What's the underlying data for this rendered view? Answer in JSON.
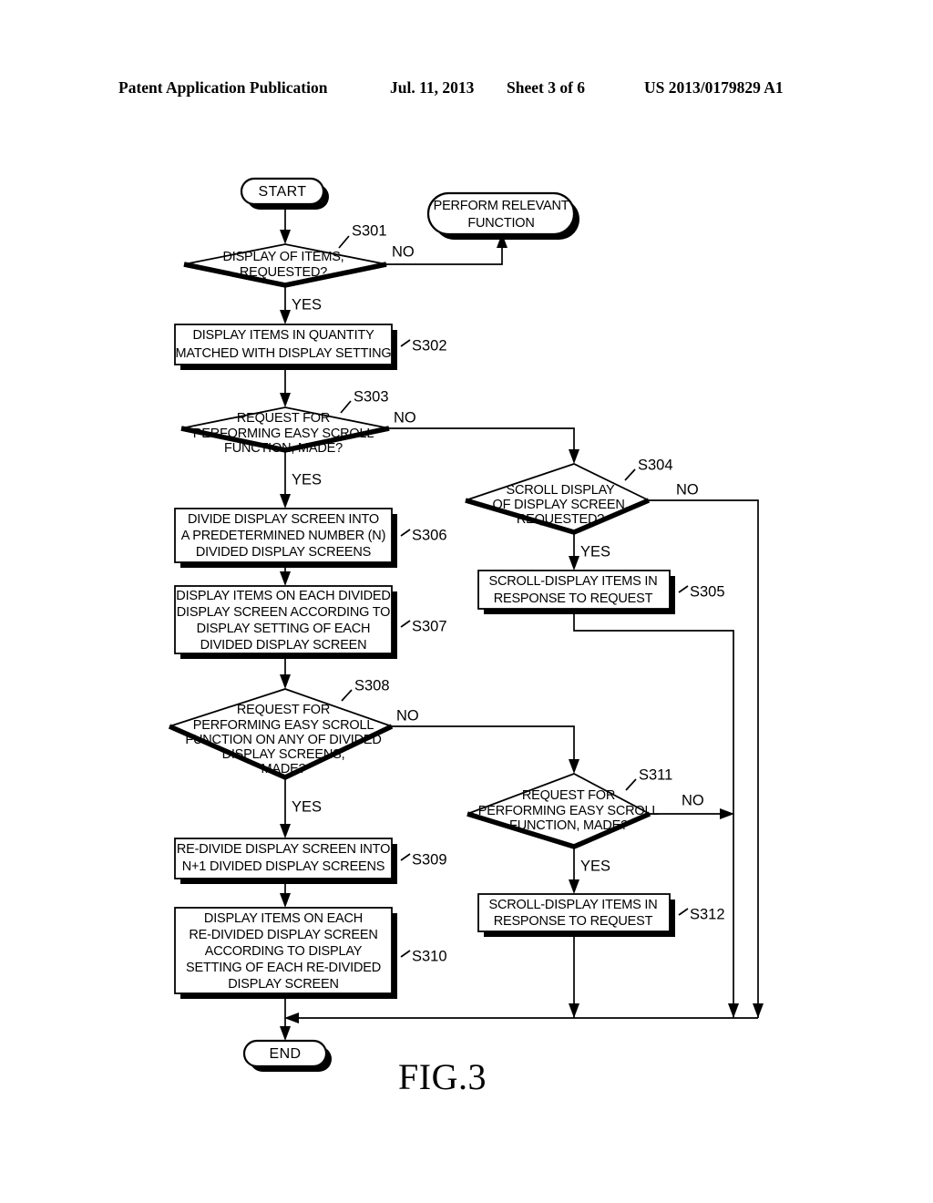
{
  "header": {
    "publication": "Patent Application Publication",
    "date": "Jul. 11, 2013",
    "sheet": "Sheet 3 of 6",
    "number": "US 2013/0179829 A1"
  },
  "figure": {
    "caption": "FIG.3"
  },
  "flowchart": {
    "terminators": {
      "start": "START",
      "end": "END",
      "perform": [
        "PERFORM RELEVANT",
        "FUNCTION"
      ]
    },
    "branch_labels": {
      "yes": "YES",
      "no": "NO"
    },
    "nodes": [
      {
        "id": "S301",
        "tag": "S301",
        "type": "decision",
        "lines": [
          "DISPLAY OF ITEMS,",
          "REQUESTED?"
        ]
      },
      {
        "id": "S302",
        "tag": "S302",
        "type": "process",
        "lines": [
          "DISPLAY ITEMS IN QUANTITY",
          "MATCHED WITH DISPLAY SETTING"
        ]
      },
      {
        "id": "S303",
        "tag": "S303",
        "type": "decision",
        "lines": [
          "REQUEST FOR",
          "PERFORMING EASY SCROLL",
          "FUNCTION, MADE?"
        ]
      },
      {
        "id": "S304",
        "tag": "S304",
        "type": "decision",
        "lines": [
          "SCROLL DISPLAY",
          "OF DISPLAY SCREEN,",
          "REQUESTED?"
        ]
      },
      {
        "id": "S305",
        "tag": "S305",
        "type": "process",
        "lines": [
          "SCROLL-DISPLAY ITEMS IN",
          "RESPONSE TO REQUEST"
        ]
      },
      {
        "id": "S306",
        "tag": "S306",
        "type": "process",
        "lines": [
          "DIVIDE DISPLAY SCREEN INTO",
          "A PREDETERMINED NUMBER (N)",
          "DIVIDED DISPLAY SCREENS"
        ]
      },
      {
        "id": "S307",
        "tag": "S307",
        "type": "process",
        "lines": [
          "DISPLAY ITEMS ON EACH DIVIDED",
          "DISPLAY SCREEN ACCORDING TO",
          "DISPLAY SETTING OF EACH",
          "DIVIDED DISPLAY SCREEN"
        ]
      },
      {
        "id": "S308",
        "tag": "S308",
        "type": "decision",
        "lines": [
          "REQUEST FOR",
          "PERFORMING EASY SCROLL",
          "FUNCTION ON ANY OF DIVIDED",
          "DISPLAY SCREENS,",
          "MADE?"
        ]
      },
      {
        "id": "S309",
        "tag": "S309",
        "type": "process",
        "lines": [
          "RE-DIVIDE DISPLAY SCREEN INTO",
          "N+1 DIVIDED DISPLAY SCREENS"
        ]
      },
      {
        "id": "S310",
        "tag": "S310",
        "type": "process",
        "lines": [
          "DISPLAY ITEMS ON EACH",
          "RE-DIVIDED DISPLAY SCREEN",
          "ACCORDING TO DISPLAY",
          "SETTING OF EACH RE-DIVIDED",
          "DISPLAY SCREEN"
        ]
      },
      {
        "id": "S311",
        "tag": "S311",
        "type": "decision",
        "lines": [
          "REQUEST FOR",
          "PERFORMING EASY SCROLL",
          "FUNCTION, MADE?"
        ]
      },
      {
        "id": "S312",
        "tag": "S312",
        "type": "process",
        "lines": [
          "SCROLL-DISPLAY ITEMS IN",
          "RESPONSE TO REQUEST"
        ]
      }
    ]
  }
}
